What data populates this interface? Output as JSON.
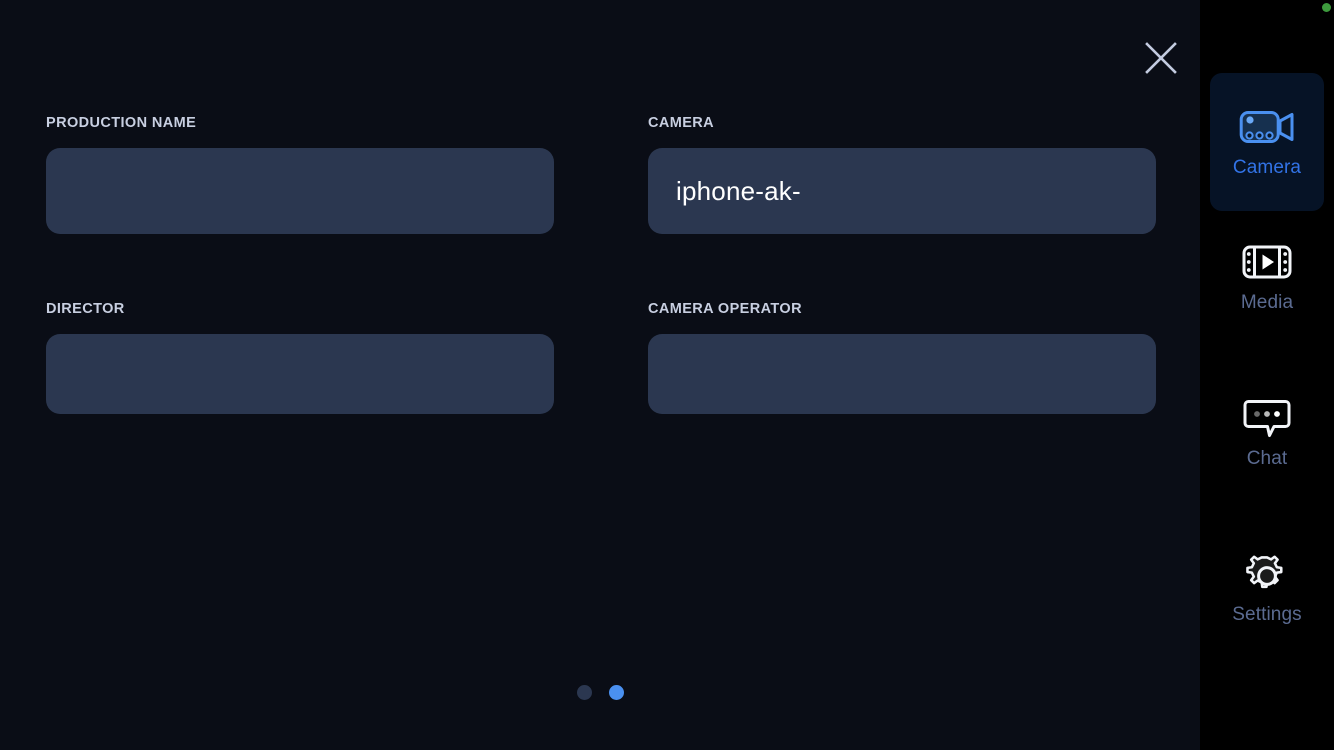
{
  "window": {
    "background_main": "#0a0d16",
    "background_sidebar": "#000000",
    "accent": "#3273e6"
  },
  "header": {
    "close_icon": "close-icon",
    "close_label": "Close"
  },
  "status": {
    "indicator_icon": "status-dot-icon",
    "indicator_color": "#3d9b3d"
  },
  "form": {
    "fields": [
      {
        "label": "PRODUCTION NAME",
        "value": "",
        "placeholder": "",
        "name": "production-name"
      },
      {
        "label": "CAMERA",
        "value": "iphone-ak-",
        "placeholder": "",
        "name": "camera"
      },
      {
        "label": "DIRECTOR",
        "value": "",
        "placeholder": "",
        "name": "director"
      },
      {
        "label": "CAMERA OPERATOR",
        "value": "",
        "placeholder": "",
        "name": "camera-operator"
      }
    ]
  },
  "pagination": {
    "dots": 2,
    "active_index": 1,
    "inactive_color": "#2b3750",
    "active_color": "#4a90f0"
  },
  "sidebar": {
    "items": [
      {
        "label": "Camera",
        "icon": "video-camera-icon",
        "active": true
      },
      {
        "label": "Media",
        "icon": "film-strip-play-icon",
        "active": false
      },
      {
        "label": "Chat",
        "icon": "speech-bubble-dots-icon",
        "active": false
      },
      {
        "label": "Settings",
        "icon": "gear-icon",
        "active": false
      }
    ]
  }
}
